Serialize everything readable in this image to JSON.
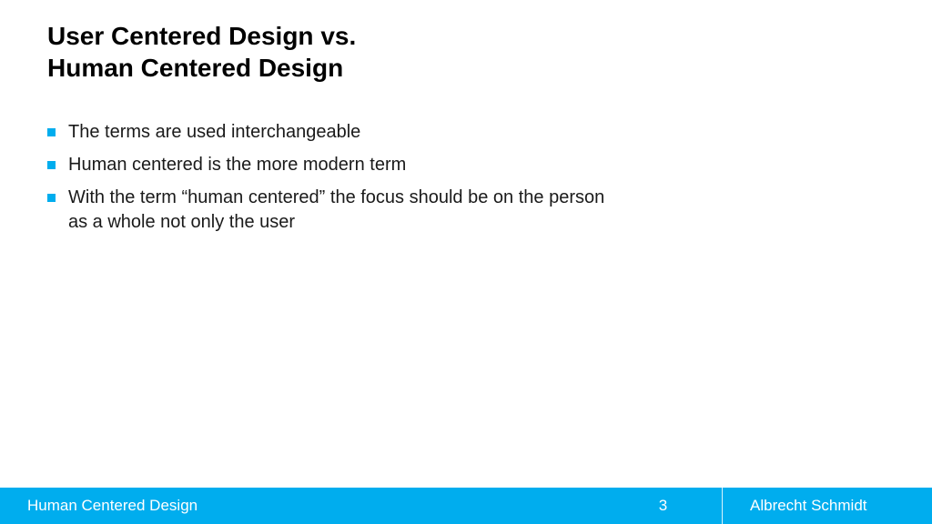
{
  "slide": {
    "title": "User Centered Design vs.\nHuman Centered Design",
    "bullets": [
      "The terms are used interchangeable",
      "Human centered is the more modern term",
      "With the term “human centered” the focus should be on the person as a whole not only the user"
    ]
  },
  "footer": {
    "course": "Human Centered Design",
    "page": "3",
    "author": "Albrecht Schmidt"
  },
  "colors": {
    "accent": "#00adee"
  }
}
